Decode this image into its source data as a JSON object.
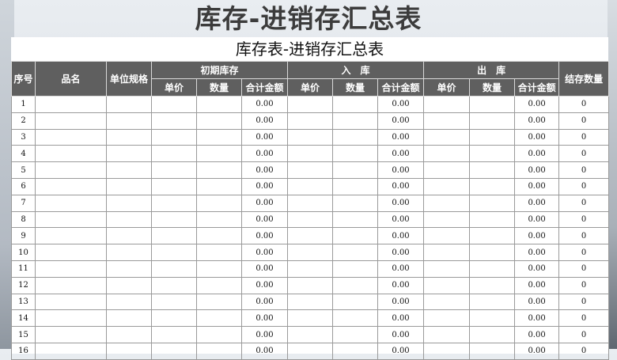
{
  "page": {
    "main_title": "库存-进销存汇总表",
    "sheet_title": "库存表-进销存汇总表"
  },
  "header": {
    "seq": "序号",
    "name": "品名",
    "unit_spec": "单位规格",
    "opening": "初期库存",
    "inbound": "入　库",
    "outbound": "出　库",
    "closing_qty": "结存数量",
    "sub": {
      "unit_price": "单价",
      "quantity": "数量",
      "total_amount": "合计金额"
    }
  },
  "rows": [
    {
      "seq": "1",
      "opening_total": "0.00",
      "in_total": "0.00",
      "out_total": "0.00",
      "closing": "0"
    },
    {
      "seq": "2",
      "opening_total": "0.00",
      "in_total": "0.00",
      "out_total": "0.00",
      "closing": "0"
    },
    {
      "seq": "3",
      "opening_total": "0.00",
      "in_total": "0.00",
      "out_total": "0.00",
      "closing": "0"
    },
    {
      "seq": "4",
      "opening_total": "0.00",
      "in_total": "0.00",
      "out_total": "0.00",
      "closing": "0"
    },
    {
      "seq": "5",
      "opening_total": "0.00",
      "in_total": "0.00",
      "out_total": "0.00",
      "closing": "0"
    },
    {
      "seq": "6",
      "opening_total": "0.00",
      "in_total": "0.00",
      "out_total": "0.00",
      "closing": "0"
    },
    {
      "seq": "7",
      "opening_total": "0.00",
      "in_total": "0.00",
      "out_total": "0.00",
      "closing": "0"
    },
    {
      "seq": "8",
      "opening_total": "0.00",
      "in_total": "0.00",
      "out_total": "0.00",
      "closing": "0"
    },
    {
      "seq": "9",
      "opening_total": "0.00",
      "in_total": "0.00",
      "out_total": "0.00",
      "closing": "0"
    },
    {
      "seq": "10",
      "opening_total": "0.00",
      "in_total": "0.00",
      "out_total": "0.00",
      "closing": "0"
    },
    {
      "seq": "11",
      "opening_total": "0.00",
      "in_total": "0.00",
      "out_total": "0.00",
      "closing": "0"
    },
    {
      "seq": "12",
      "opening_total": "0.00",
      "in_total": "0.00",
      "out_total": "0.00",
      "closing": "0"
    },
    {
      "seq": "13",
      "opening_total": "0.00",
      "in_total": "0.00",
      "out_total": "0.00",
      "closing": "0"
    },
    {
      "seq": "14",
      "opening_total": "0.00",
      "in_total": "0.00",
      "out_total": "0.00",
      "closing": "0"
    },
    {
      "seq": "15",
      "opening_total": "0.00",
      "in_total": "0.00",
      "out_total": "0.00",
      "closing": "0"
    },
    {
      "seq": "16",
      "opening_total": "0.00",
      "in_total": "0.00",
      "out_total": "0.00",
      "closing": "0"
    }
  ]
}
